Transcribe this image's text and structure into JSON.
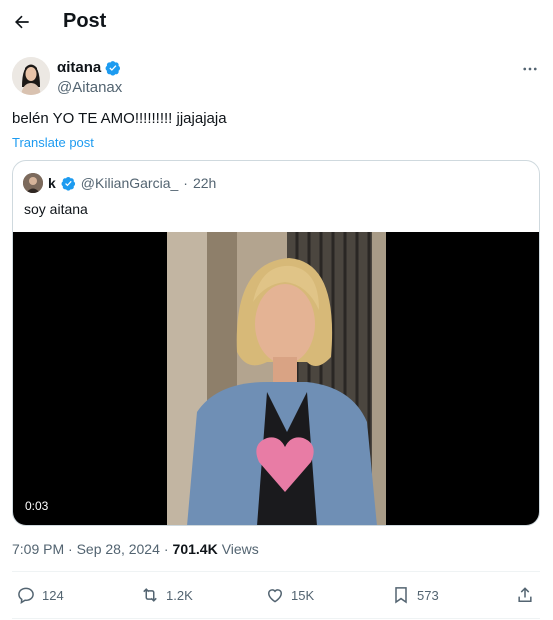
{
  "header": {
    "title": "Post"
  },
  "tweet": {
    "author_name": "αitana",
    "author_handle": "@Aitanax",
    "text": "belén YO TE AMO!!!!!!!!! jjajajaja",
    "translate_label": "Translate post",
    "timestamp": "7:09 PM · Sep 28, 2024",
    "views_count": "701.4K",
    "views_label": "Views"
  },
  "quote": {
    "author_name": "k",
    "author_handle": "@KilianGarcia_",
    "time": "22h",
    "text": "soy aitana",
    "video_duration": "0:03"
  },
  "actions": {
    "replies": "124",
    "reposts": "1.2K",
    "likes": "15K",
    "bookmarks": "573"
  },
  "colors": {
    "accent": "#1d9bf0",
    "secondary_text": "#536471",
    "border": "#cfd9de"
  }
}
